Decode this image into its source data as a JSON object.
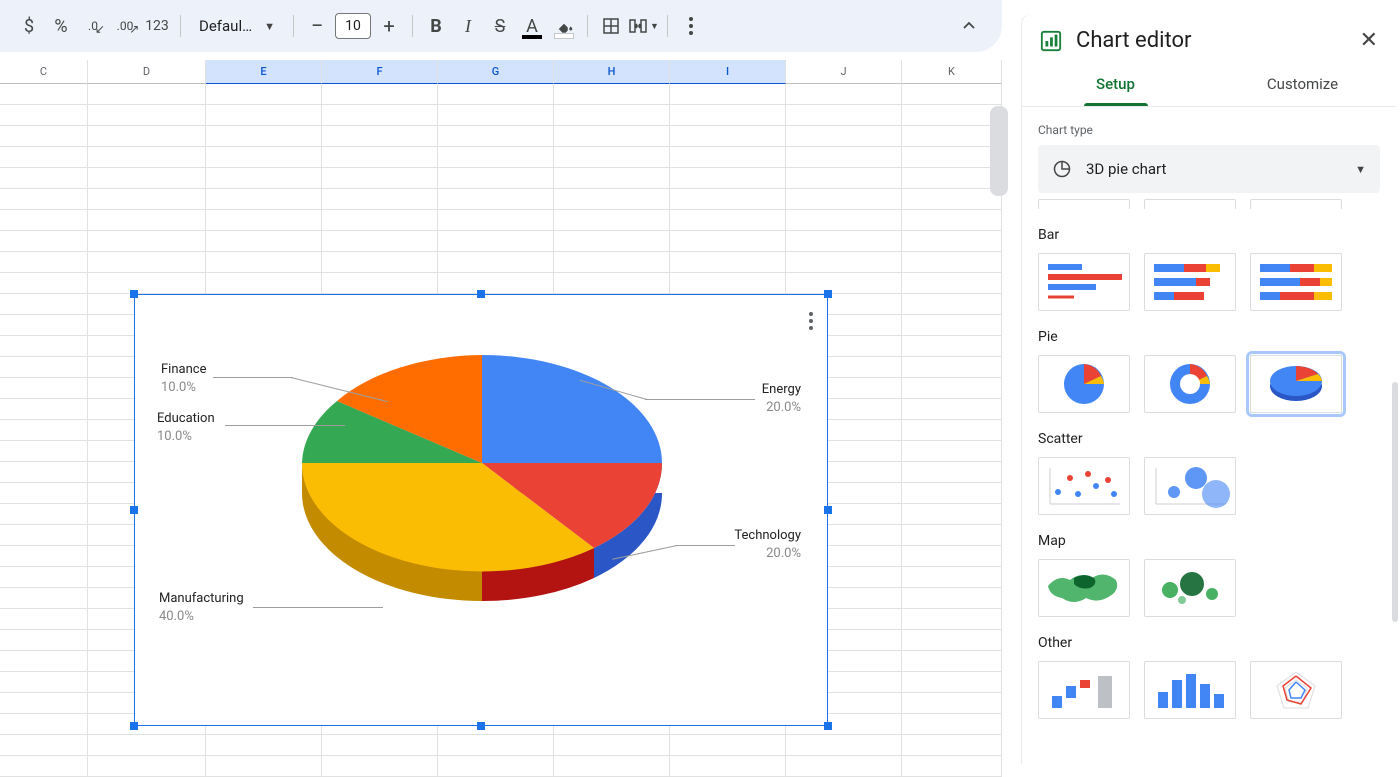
{
  "toolbar": {
    "currency": "$",
    "percent": "%",
    "dec_dec": ".0",
    "dec_inc": ".00",
    "num_fmt": "123",
    "font_name": "Defaul…",
    "font_size": "10",
    "bold": "B",
    "italic": "I",
    "strike": "S"
  },
  "columns": [
    "C",
    "D",
    "E",
    "F",
    "G",
    "H",
    "I",
    "J",
    "K"
  ],
  "selected_columns": [
    "E",
    "F",
    "G",
    "H",
    "I"
  ],
  "chart_data": {
    "type": "pie",
    "title": "",
    "slices": [
      {
        "label": "Energy",
        "value": 20.0,
        "pct": "20.0%",
        "color": "#4285f4"
      },
      {
        "label": "Technology",
        "value": 20.0,
        "pct": "20.0%",
        "color": "#ea4335"
      },
      {
        "label": "Manufacturing",
        "value": 40.0,
        "pct": "40.0%",
        "color": "#fbbc04"
      },
      {
        "label": "Education",
        "value": 10.0,
        "pct": "10.0%",
        "color": "#34a853"
      },
      {
        "label": "Finance",
        "value": 10.0,
        "pct": "10.0%",
        "color": "#ff6d01"
      }
    ]
  },
  "sidebar": {
    "title": "Chart editor",
    "tabs": {
      "setup": "Setup",
      "customize": "Customize"
    },
    "chart_type_label": "Chart type",
    "chart_type_value": "3D pie chart",
    "sections": {
      "bar": "Bar",
      "pie": "Pie",
      "scatter": "Scatter",
      "map": "Map",
      "other": "Other"
    }
  }
}
